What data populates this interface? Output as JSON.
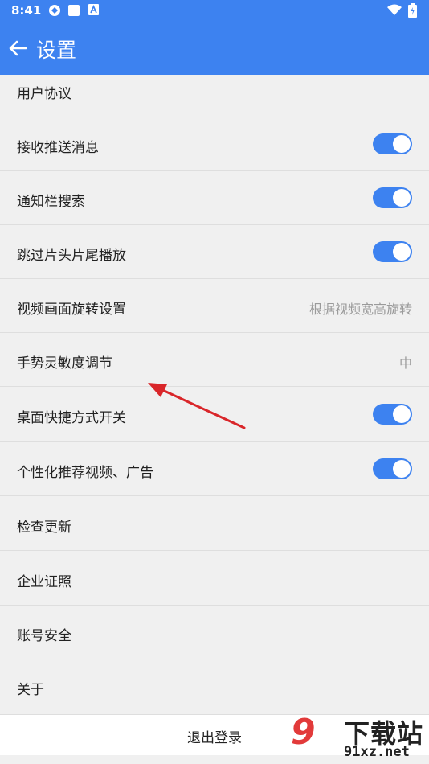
{
  "status_bar": {
    "time": "8:41",
    "icons": [
      "sync-icon",
      "notification-square-icon",
      "app-a-icon",
      "wifi-icon",
      "battery-icon"
    ]
  },
  "app_bar": {
    "title": "设置",
    "back_icon": "arrow-left-icon",
    "background": "#3d82f0"
  },
  "settings": {
    "partial_item": "用户协议",
    "push": {
      "label": "接收推送消息",
      "enabled": true
    },
    "notif_search": {
      "label": "通知栏搜索",
      "enabled": true
    },
    "skip_intro": {
      "label": "跳过片头片尾播放",
      "enabled": true
    },
    "rotation": {
      "label": "视频画面旋转设置",
      "value": "根据视频宽高旋转"
    },
    "gesture": {
      "label": "手势灵敏度调节",
      "value": "中"
    },
    "shortcut": {
      "label": "桌面快捷方式开关",
      "enabled": true
    },
    "personalized": {
      "label": "个性化推荐视频、广告",
      "enabled": true
    },
    "update": {
      "label": "检查更新"
    },
    "license": {
      "label": "企业证照"
    },
    "security": {
      "label": "账号安全"
    },
    "about": {
      "label": "关于"
    }
  },
  "logout": {
    "label": "退出登录"
  },
  "watermark": {
    "number": "9",
    "cn": "下载站",
    "en": "91xz.net"
  },
  "colors": {
    "accent": "#3d82f0",
    "annotation": "#d9262a"
  }
}
